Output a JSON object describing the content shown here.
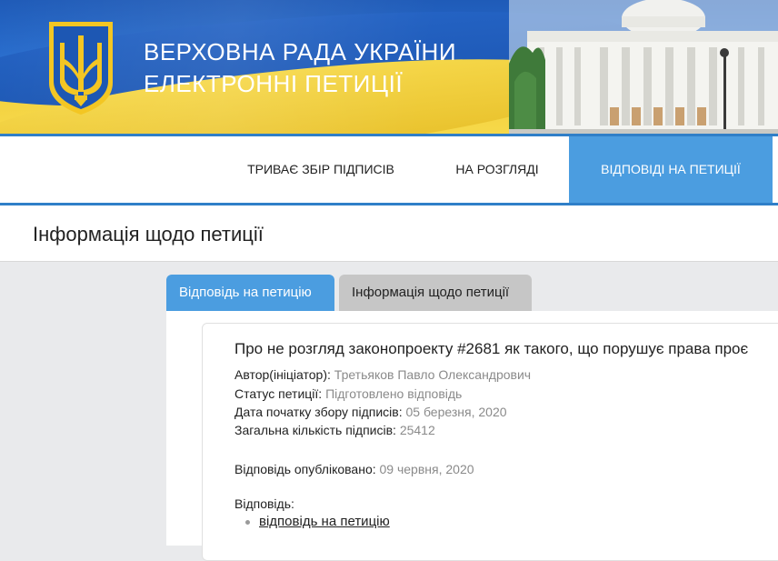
{
  "header": {
    "title_line1": "ВЕРХОВНА РАДА УКРАЇНИ",
    "title_line2": "ЕЛЕКТРОННІ ПЕТИЦІЇ",
    "emblem_icon": "trident-emblem-icon",
    "colors": {
      "blue": "#1f5bb8",
      "yellow": "#f2d03b",
      "accent": "#4b9de0"
    }
  },
  "nav": {
    "items": [
      {
        "label": "ТРИВАЄ ЗБІР ПІДПИСІВ",
        "active": false
      },
      {
        "label": "НА РОЗГЛЯДІ",
        "active": false
      },
      {
        "label": "ВІДПОВІДІ НА ПЕТИЦІЇ",
        "active": true
      }
    ]
  },
  "page": {
    "title": "Інформація щодо петиції"
  },
  "tabs": [
    {
      "label": "Відповідь на петицію",
      "active": true
    },
    {
      "label": "Інформація щодо петиції",
      "active": false
    }
  ],
  "petition": {
    "title": "Про не розгляд законопроекту #2681 як такого, що порушує права проє",
    "author_label": "Автор(ініціатор):",
    "author": "Третьяков Павло Олександрович",
    "status_label": "Статус петиції:",
    "status": "Підготовлено відповідь",
    "start_label": "Дата початку збору підписів:",
    "start_date": "05 березня, 2020",
    "count_label": "Загальна кількість підписів:",
    "count": "25412",
    "published_label": "Відповідь опубліковано:",
    "published_date": "09 червня, 2020",
    "response_label": "Відповідь:",
    "response_link": "відповідь на петицію"
  }
}
